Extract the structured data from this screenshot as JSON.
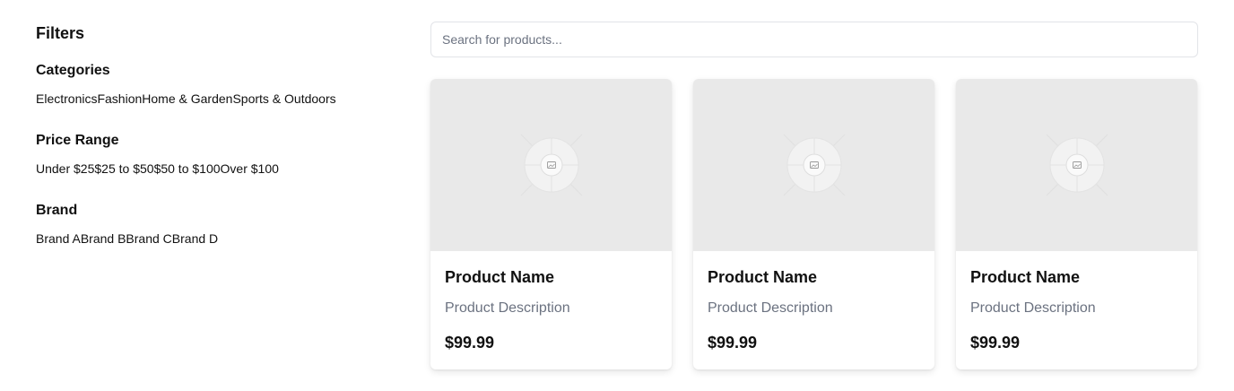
{
  "sidebar": {
    "title": "Filters",
    "groups": [
      {
        "title": "Categories",
        "options": [
          "Electronics",
          "Fashion",
          "Home & Garden",
          "Sports & Outdoors"
        ]
      },
      {
        "title": "Price Range",
        "options": [
          "Under $25",
          "$25 to $50",
          "$50 to $100",
          "Over $100"
        ]
      },
      {
        "title": "Brand",
        "options": [
          "Brand A",
          "Brand B",
          "Brand C",
          "Brand D"
        ]
      }
    ]
  },
  "search": {
    "placeholder": "Search for products...",
    "value": ""
  },
  "products": [
    {
      "name": "Product Name",
      "description": "Product Description",
      "price": "$99.99",
      "image_icon": "image-placeholder-icon"
    },
    {
      "name": "Product Name",
      "description": "Product Description",
      "price": "$99.99",
      "image_icon": "image-placeholder-icon"
    },
    {
      "name": "Product Name",
      "description": "Product Description",
      "price": "$99.99",
      "image_icon": "image-placeholder-icon"
    }
  ]
}
